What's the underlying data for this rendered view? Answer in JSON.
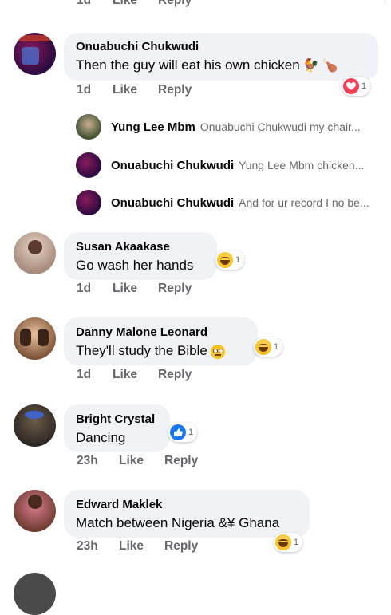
{
  "top_meta": {
    "time": "1d",
    "like": "Like",
    "reply": "Reply"
  },
  "c1": {
    "name": "Onuabuchi Chukwudi",
    "text": "Then the guy will eat his own chicken",
    "time": "1d",
    "like": "Like",
    "reply": "Reply",
    "reaction": {
      "type": "love-icon",
      "count": "1"
    }
  },
  "replies": [
    {
      "name": "Yung Lee Mbm",
      "preview": "Onuabuchi Chukwudi my chair..."
    },
    {
      "name": "Onuabuchi Chukwudi",
      "preview": "Yung Lee Mbm chicken..."
    },
    {
      "name": "Onuabuchi Chukwudi",
      "preview": "And for ur record I no be..."
    }
  ],
  "c2": {
    "name": "Susan Akaakase",
    "text": "Go wash her hands",
    "time": "1d",
    "like": "Like",
    "reply": "Reply",
    "reaction": {
      "type": "haha-icon",
      "count": "1"
    }
  },
  "c3": {
    "name": "Danny Malone Leonard",
    "text": "They'll study the Bible",
    "time": "1d",
    "like": "Like",
    "reply": "Reply",
    "reaction": {
      "type": "haha-icon",
      "count": "1"
    }
  },
  "c4": {
    "name": "Bright Crystal",
    "text": "Dancing",
    "time": "23h",
    "like": "Like",
    "reply": "Reply",
    "reaction": {
      "type": "like-icon",
      "count": "1"
    }
  },
  "c5": {
    "name": "Edward Maklek",
    "text": "Match between Nigeria &¥ Ghana",
    "time": "23h",
    "like": "Like",
    "reply": "Reply",
    "reaction": {
      "type": "haha-icon",
      "count": "1"
    }
  },
  "colors": {
    "bubble": "#f0f2f5",
    "meta": "#65676b",
    "love": "#f33e58",
    "like": "#1877f2"
  }
}
